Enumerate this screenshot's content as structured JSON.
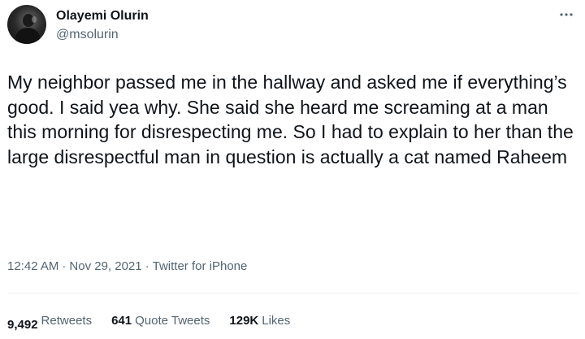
{
  "author": {
    "display_name": "Olayemi Olurin",
    "handle": "@msolurin"
  },
  "menu": {
    "icon": "more-horizontal-icon"
  },
  "tweet": {
    "text": "My neighbor passed me in the hallway and asked me if everything’s good. I said yea why. She said she heard me screaming at a man this morning for disrespecting me. So I had to explain to her than the large disrespectful man in question is actually a cat named Raheem"
  },
  "meta": {
    "time": "12:42 AM",
    "separator": "·",
    "date": "Nov 29, 2021",
    "source": "Twitter for iPhone"
  },
  "stats": {
    "retweets_count": "9,492",
    "retweets_label": "Retweets",
    "quotes_count": "641",
    "quotes_label": "Quote Tweets",
    "likes_count": "129K",
    "likes_label": "Likes"
  },
  "colors": {
    "primary_text": "#0f1419",
    "secondary_text": "#536471",
    "divider": "#eff3f4"
  }
}
